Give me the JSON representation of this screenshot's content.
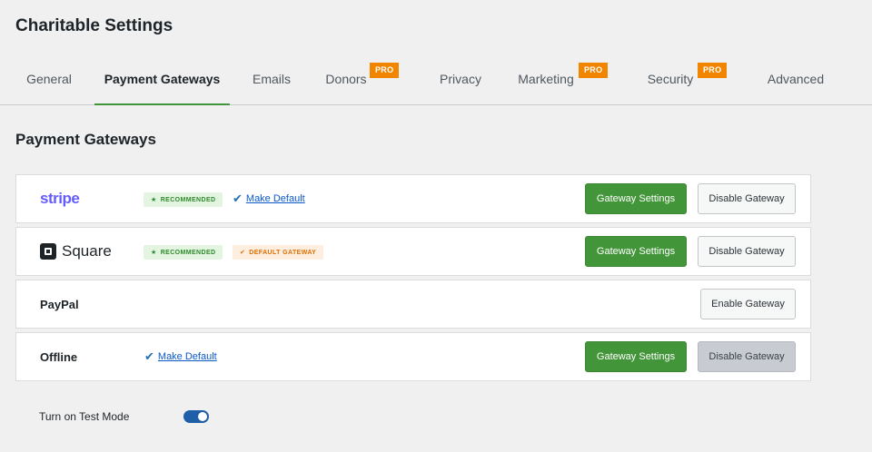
{
  "page": {
    "title": "Charitable Settings"
  },
  "tabs": [
    {
      "label": "General",
      "active": false,
      "pro": ""
    },
    {
      "label": "Payment Gateways",
      "active": true,
      "pro": ""
    },
    {
      "label": "Emails",
      "active": false,
      "pro": ""
    },
    {
      "label": "Donors",
      "active": false,
      "pro": "PRO"
    },
    {
      "label": "Privacy",
      "active": false,
      "pro": ""
    },
    {
      "label": "Marketing",
      "active": false,
      "pro": "PRO"
    },
    {
      "label": "Security",
      "active": false,
      "pro": "PRO"
    },
    {
      "label": "Advanced",
      "active": false,
      "pro": ""
    }
  ],
  "section": {
    "title": "Payment Gateways"
  },
  "gateways": [
    {
      "name": "stripe",
      "recommended": "RECOMMENDED",
      "make_default": "Make Default",
      "settings_button": "Gateway Settings",
      "action_button": "Disable Gateway"
    },
    {
      "name": "Square",
      "recommended": "RECOMMENDED",
      "default_badge": "DEFAULT GATEWAY",
      "settings_button": "Gateway Settings",
      "action_button": "Disable Gateway"
    },
    {
      "name": "PayPal",
      "action_button": "Enable Gateway"
    },
    {
      "name": "Offline",
      "make_default": "Make Default",
      "settings_button": "Gateway Settings",
      "action_button": "Disable Gateway"
    }
  ],
  "test_mode": {
    "label": "Turn on Test Mode",
    "enabled": true
  },
  "colors": {
    "accent_green": "#43953a",
    "pro_orange": "#f18500",
    "toggle_blue": "#1f5fa8"
  }
}
